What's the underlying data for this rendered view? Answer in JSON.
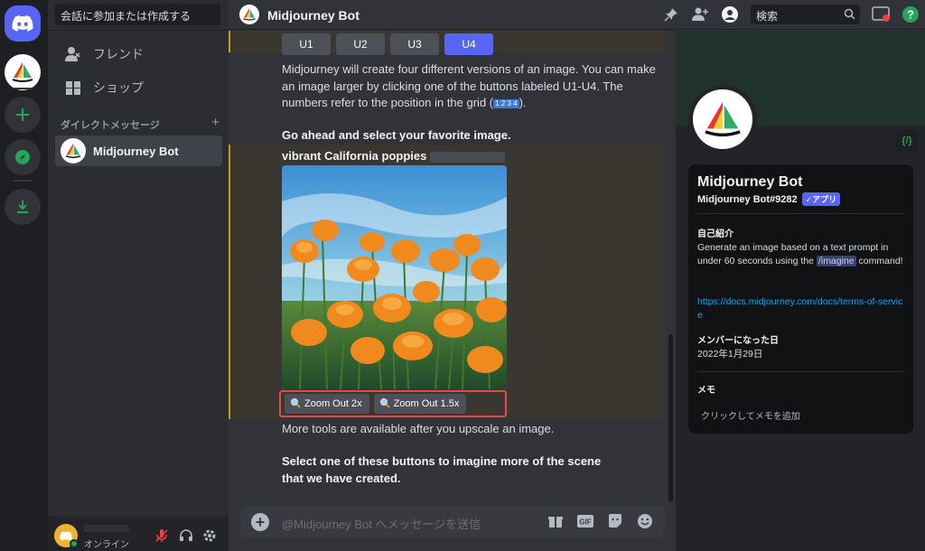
{
  "sidebar": {
    "search_placeholder": "会話に参加または作成する",
    "friends_label": "フレンド",
    "shop_label": "ショップ",
    "dm_header": "ダイレクトメッセージ",
    "dm_add": "+",
    "dm_items": [
      {
        "name": "Midjourney Bot"
      }
    ]
  },
  "user_panel": {
    "status": "オンライン"
  },
  "topbar": {
    "title": "Midjourney Bot",
    "search_placeholder": "検索"
  },
  "chat": {
    "upscale_buttons": [
      "U1",
      "U2",
      "U3",
      "U4"
    ],
    "active_upscale": "U4",
    "message1_part1": "Midjourney will create four different versions of an image. You can make an image larger by clicking one of the buttons labeled U1-U4. The numbers refer to the position in the grid (",
    "grid_emoji": "1 2 3 4",
    "message1_part2": ").",
    "message2": "Go ahead and select your favorite image.",
    "prompt_text": "vibrant California poppies",
    "zoom_buttons": [
      "Zoom Out 2x",
      "Zoom Out 1.5x"
    ],
    "message3": "More tools are available after you upscale an image.",
    "message4": "Select one of these buttons to imagine more of the scene that we have created.",
    "composer_placeholder": "@Midjourney Bot へメッセージを送信"
  },
  "profile": {
    "name": "Midjourney Bot",
    "tag": "Midjourney Bot#9282",
    "app_badge": "✓アプリ",
    "about_label": "自己紹介",
    "about_text_1": "Generate an image based on a text prompt in under 60 seconds using the ",
    "about_command": "/imagine",
    "about_text_2": " command!",
    "link": "https://docs.midjourney.com/docs/terms-of-service",
    "member_since_label": "メンバーになった日",
    "member_since": "2022年1月29日",
    "memo_label": "メモ",
    "memo_placeholder": "クリックしてメモを追加",
    "dev_badge": "{/}"
  },
  "colors": {
    "accent": "#5865f2",
    "highlight_border": "#c79a1a",
    "zoom_outline": "#e5484d",
    "online": "#23a55a"
  }
}
